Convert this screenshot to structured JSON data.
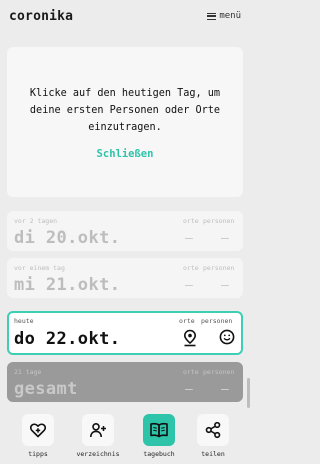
{
  "header": {
    "brand": "coronika",
    "menu_label": "menü"
  },
  "notice": {
    "text": "Klicke auf den heutigen Tag, um deine ersten Personen oder Orte einzutragen.",
    "close_label": "Schließen"
  },
  "days": [
    {
      "sub": "vor 2 tagen",
      "date": "di 20.okt.",
      "places_header": "orte",
      "persons_header": "personen",
      "places": "–",
      "persons": "–"
    },
    {
      "sub": "vor einem tag",
      "date": "mi 21.okt.",
      "places_header": "orte",
      "persons_header": "personen",
      "places": "–",
      "persons": "–"
    },
    {
      "sub": "heute",
      "date": "do 22.okt.",
      "places_header": "orte",
      "persons_header": "personen",
      "places_icon": "location-pin-icon",
      "persons_icon": "smiley-icon"
    },
    {
      "sub": "21 tage",
      "date": "gesamt",
      "places_header": "orte",
      "persons_header": "personen",
      "places": "–",
      "persons": "–"
    }
  ],
  "tabs": [
    {
      "label": "tipps",
      "icon": "heart-plus-icon",
      "active": false
    },
    {
      "label": "verzeichnis",
      "icon": "add-person-icon",
      "active": false
    },
    {
      "label": "tagebuch",
      "icon": "book-icon",
      "active": true
    },
    {
      "label": "teilen",
      "icon": "share-icon",
      "active": false
    }
  ],
  "colors": {
    "accent": "#2ec4a9",
    "background": "#ececec",
    "total_card": "#9a9a9a"
  }
}
